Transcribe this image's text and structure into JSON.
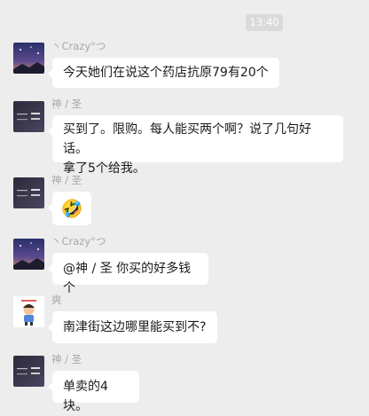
{
  "timestamp": "13:40",
  "messages": [
    {
      "sender": "丶Crazy°つ",
      "lines": [
        "今天她们在说这个药店抗原79有20个"
      ],
      "avatar": "night-sky-avatar"
    },
    {
      "sender": "神 / 圣",
      "lines": [
        "买到了。限购。每人能买两个啊？说了几句好话。",
        "拿了5个给我。"
      ],
      "avatar": "dark-text-avatar"
    },
    {
      "sender": "神 / 圣",
      "lines": [
        "🤣"
      ],
      "avatar": "dark-text-avatar"
    },
    {
      "sender": "丶Crazy°つ",
      "lines": [
        "@神 / 圣 你买的好多钱个"
      ],
      "avatar": "night-sky-avatar"
    },
    {
      "sender": "爽",
      "lines": [
        "南津街这边哪里能买到不?"
      ],
      "avatar": "cartoon-avatar"
    },
    {
      "sender": "神 / 圣",
      "lines": [
        "单卖的4块。"
      ],
      "avatar": "dark-text-avatar"
    }
  ]
}
